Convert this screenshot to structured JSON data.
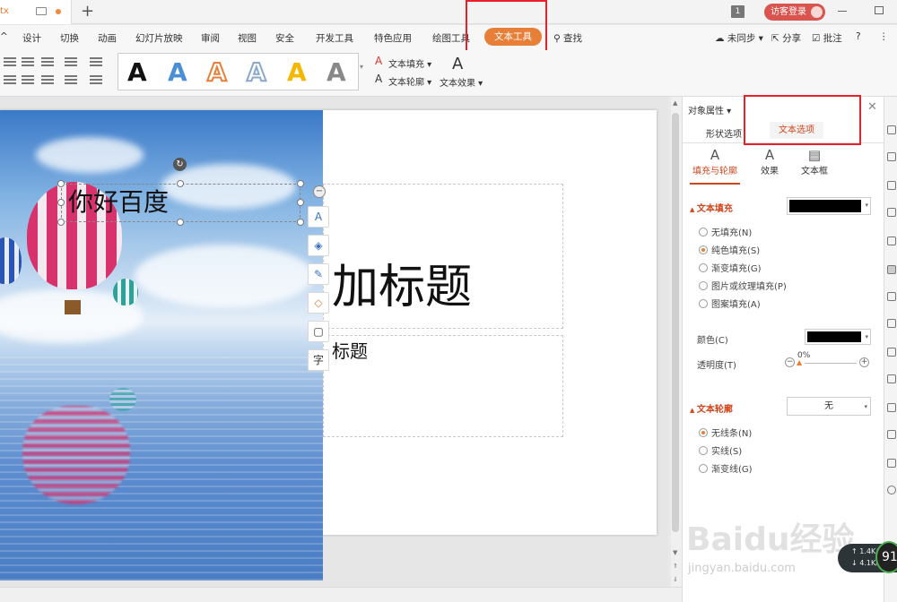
{
  "titlebar": {
    "doc_tab_name": "tx",
    "new_tab": "+",
    "badge": "1",
    "login": "访客登录"
  },
  "menu": {
    "items": [
      "设计",
      "切换",
      "动画",
      "幻灯片放映",
      "审阅",
      "视图",
      "安全",
      "开发工具",
      "特色应用",
      "绘图工具"
    ],
    "active_tab": "文本工具",
    "search": "查找",
    "right_items": [
      "未同步",
      "分享",
      "批注"
    ]
  },
  "ribbon": {
    "styles": [
      "A",
      "A",
      "A",
      "A",
      "A",
      "A"
    ],
    "text_fill": "文本填充",
    "text_outline": "文本轮廓",
    "text_effect": "文本效果"
  },
  "slide": {
    "textbox_text": "你好百度",
    "title_text": "加标题",
    "subtitle_text": "标题"
  },
  "float_toolbar": {
    "char_btn": "字"
  },
  "pane": {
    "title": "对象属性",
    "tabs": [
      "形状选项",
      "文本选项"
    ],
    "sub_tabs": [
      "填充与轮廓",
      "效果",
      "文本框"
    ],
    "fill_section": "文本填充",
    "fill_options": [
      "无填充(N)",
      "纯色填充(S)",
      "渐变填充(G)",
      "图片或纹理填充(P)",
      "图案填充(A)"
    ],
    "fill_selected": 1,
    "color_label": "颜色(C)",
    "transparency_label": "透明度(T)",
    "transparency_value": "0%",
    "outline_section": "文本轮廓",
    "outline_value": "无",
    "outline_options": [
      "无线条(N)",
      "实线(S)",
      "渐变线(G)"
    ],
    "outline_selected": 0,
    "colors": {
      "fill": "#000000",
      "accent": "#e87f38",
      "active_text": "#d0451b"
    }
  },
  "watermark": {
    "brand": "Baidu经验",
    "url": "jingyan.baidu.com"
  },
  "speed": {
    "up": "1.4",
    "down": "4.1",
    "unit": "K/s",
    "percent": "91"
  }
}
